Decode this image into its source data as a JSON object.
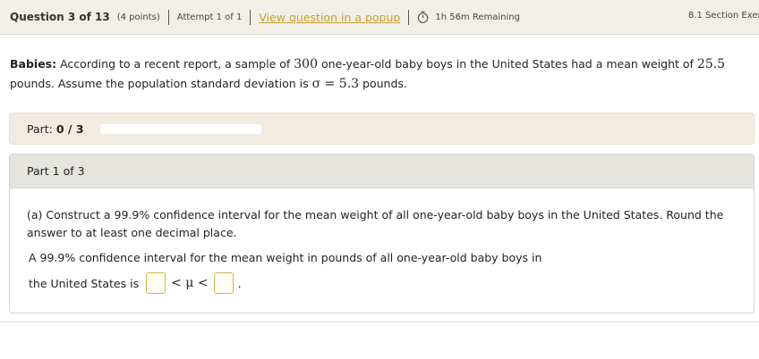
{
  "header": {
    "question_label": "Question 3 of 13",
    "points": "(4 points)",
    "attempt": "Attempt 1 of 1",
    "popup_link": "View question in a popup",
    "time_remaining": "1h 56m Remaining",
    "section": "8.1 Section Exer"
  },
  "problem": {
    "topic": "Babies:",
    "text_1": " According to a recent report, a sample of ",
    "n": "300",
    "text_2": " one-year-old baby boys in the United States had a mean weight of ",
    "mean": "25.5",
    "text_3": " pounds. Assume the population standard deviation is ",
    "sigma_expr": "σ = 5.3",
    "text_4": " pounds."
  },
  "progress": {
    "label": "Part: ",
    "count": "0 / 3",
    "fraction": 0
  },
  "part": {
    "header": "Part 1 of 3",
    "question": "(a) Construct a 99.9% confidence interval for the mean weight of all one-year-old baby boys in the United States. Round the answer to at least one decimal place.",
    "answer_line1": "A 99.9% confidence interval for the mean weight in pounds of all one-year-old baby boys in",
    "answer_line2_prefix": "the United States is",
    "inequality_middle": "< μ <",
    "answer_suffix": ".",
    "lower_value": "",
    "upper_value": ""
  },
  "colors": {
    "accent": "#c8a02a",
    "topbar_bg": "#f2efe9",
    "progress_bg": "#f2ebe0",
    "part_header_bg": "#e6e4df"
  }
}
